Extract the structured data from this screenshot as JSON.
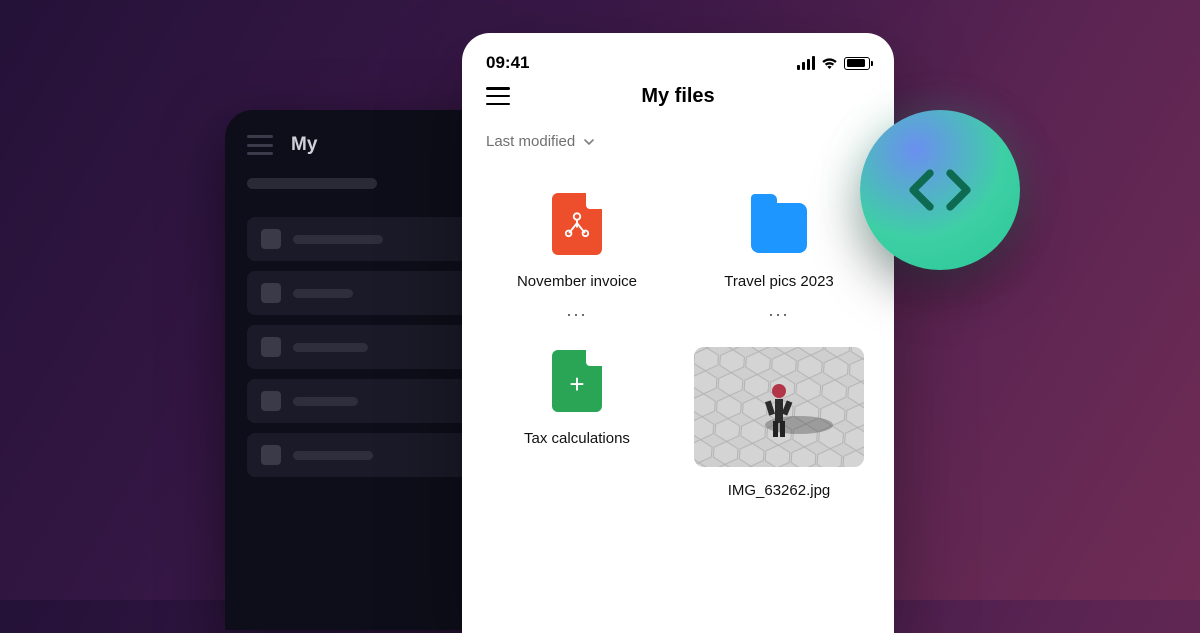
{
  "statusbar": {
    "time": "09:41"
  },
  "bg": {
    "title_partial": "My"
  },
  "header": {
    "title": "My files"
  },
  "sort": {
    "label": "Last modified"
  },
  "files": [
    {
      "name": "November invoice",
      "kind": "pdf"
    },
    {
      "name": "Travel pics 2023",
      "kind": "folder"
    },
    {
      "name": "Tax calculations",
      "kind": "sheet"
    },
    {
      "name": "IMG_63262.jpg",
      "kind": "image"
    }
  ],
  "more_glyph": "..."
}
